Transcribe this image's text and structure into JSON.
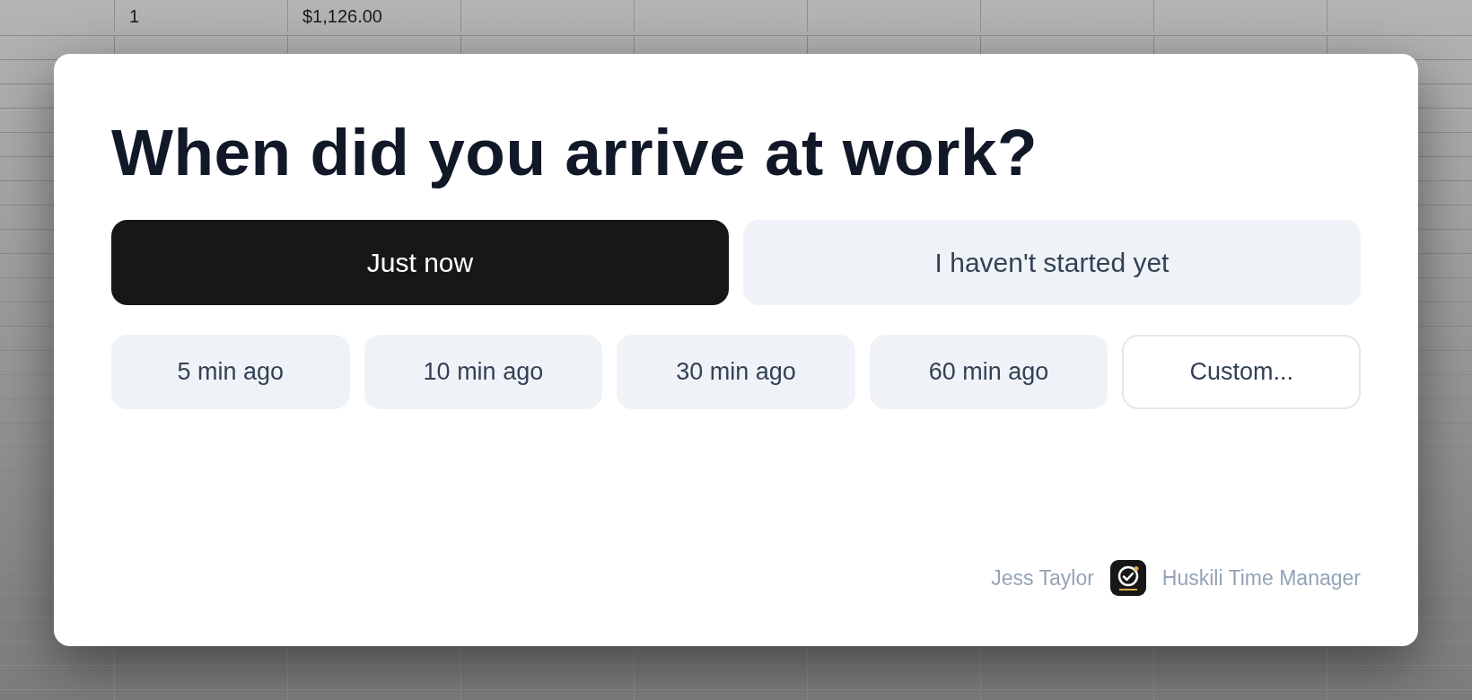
{
  "spreadsheet": {
    "rows": [
      [
        null,
        "1",
        "$1,126.00"
      ]
    ]
  },
  "dialog": {
    "title": "When did you arrive at work?",
    "main_options": [
      {
        "label": "Just now",
        "kind": "primary"
      },
      {
        "label": "I haven't started yet",
        "kind": "secondary"
      }
    ],
    "time_options": [
      {
        "label": "5 min ago",
        "kind": "secondary"
      },
      {
        "label": "10 min ago",
        "kind": "secondary"
      },
      {
        "label": "30 min ago",
        "kind": "secondary"
      },
      {
        "label": "60 min ago",
        "kind": "secondary"
      },
      {
        "label": "Custom...",
        "kind": "outline"
      }
    ],
    "footer": {
      "user": "Jess Taylor",
      "app_name": "Huskili Time Manager"
    }
  }
}
